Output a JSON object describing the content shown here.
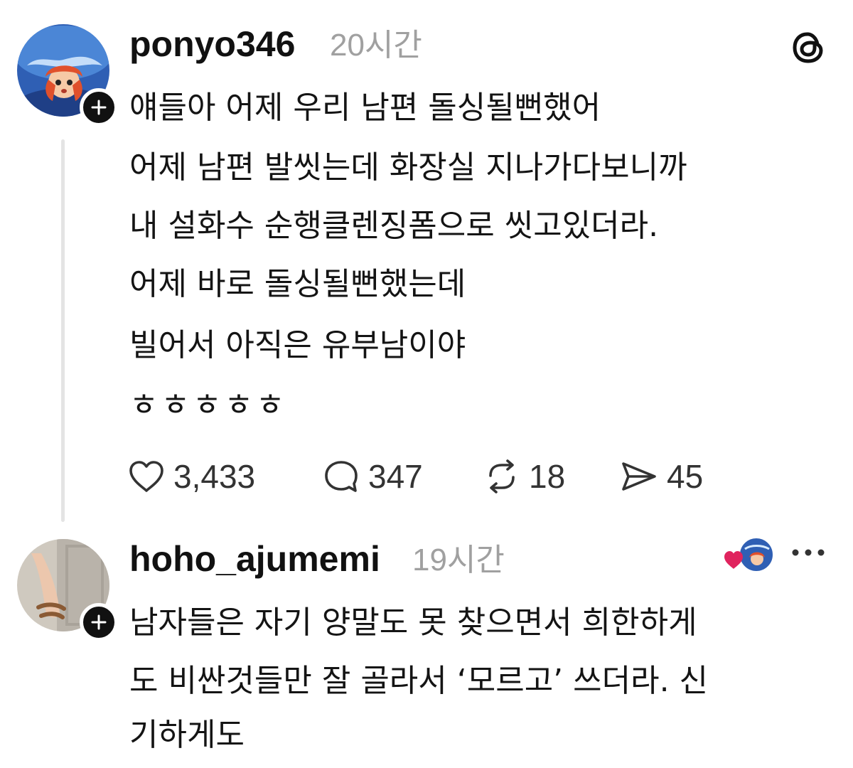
{
  "post": {
    "username": "ponyo346",
    "time": "20시간",
    "lines": [
      "얘들아 어제 우리 남편 돌싱될뻔했어",
      "어제 남편 발씻는데 화장실 지나가다보니까",
      "내 설화수 순행클렌징폼으로 씻고있더라.",
      "어제 바로 돌싱될뻔했는데",
      "빌어서 아직은 유부남이야",
      "ㅎㅎㅎㅎㅎ"
    ],
    "actions": {
      "likes": "3,433",
      "replies": "347",
      "reposts": "18",
      "shares": "45"
    }
  },
  "reply": {
    "username": "hoho_ajumemi",
    "time": "19시간",
    "lines": [
      "남자들은 자기 양말도 못 찾으면서 희한하게",
      "도 비싼것들만 잘 골라서 ‘모르고’ 쓰더라. 신",
      "기하게도"
    ]
  },
  "icons": {
    "app_logo": "threads-logo-icon",
    "follow": "plus-icon",
    "like": "heart-icon",
    "reply": "speech-bubble-icon",
    "repost": "repost-icon",
    "share": "send-icon",
    "liked_by_author": "heart-avatar-icon",
    "more": "more-dots-icon"
  },
  "colors": {
    "text": "#111111",
    "muted": "#a0a0a0",
    "thread_line": "#e4e4e4",
    "liked_heart": "#e0245e"
  }
}
